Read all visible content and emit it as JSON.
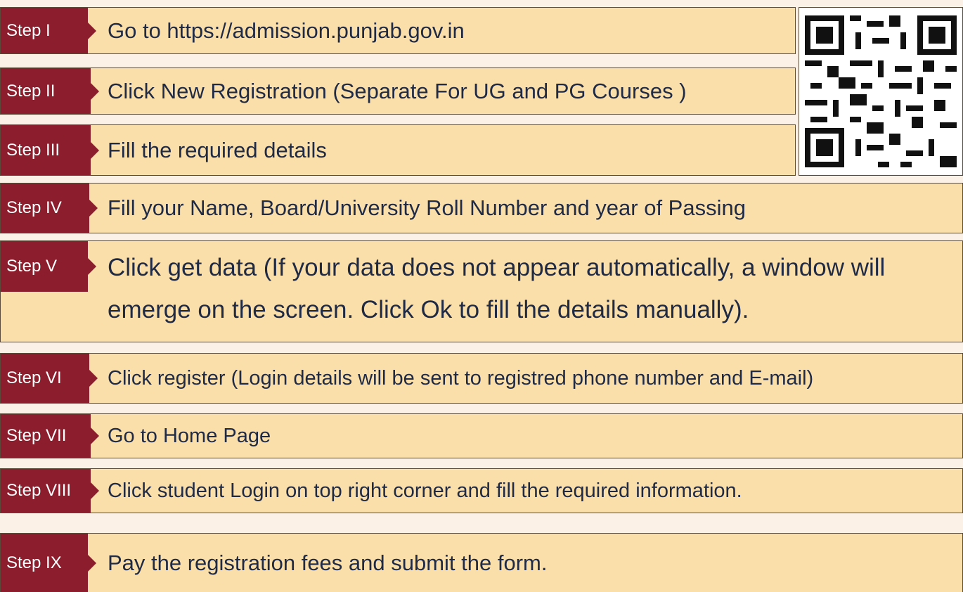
{
  "steps": [
    {
      "label": "Step I",
      "text": "Go to https://admission.punjab.gov.in"
    },
    {
      "label": "Step II",
      "text": "Click New Registration (Separate For UG and PG Courses )"
    },
    {
      "label": "Step III",
      "text": "Fill the required details"
    },
    {
      "label": "Step IV",
      "text": "Fill your Name, Board/University Roll Number and year of Passing"
    },
    {
      "label": "Step V",
      "text": "Click get data (If your data does not appear automatically, a window will emerge  on the screen. Click Ok to fill the details manually)."
    },
    {
      "label": "Step VI",
      "text": "Click register (Login details will be sent to registred phone number and E-mail)"
    },
    {
      "label": "Step VII",
      "text": "Go to Home Page"
    },
    {
      "label": "Step VIII",
      "text": "Click student Login on top right corner and fill the required information."
    },
    {
      "label": "Step IX",
      "text": "Pay the registration fees and submit the form."
    }
  ],
  "qr_code": {
    "icon": "qr-code-icon"
  },
  "colors": {
    "background": "#fcf1e6",
    "row": "#fbdfab",
    "tag": "#8b1d2c",
    "text": "#1f2a44"
  }
}
